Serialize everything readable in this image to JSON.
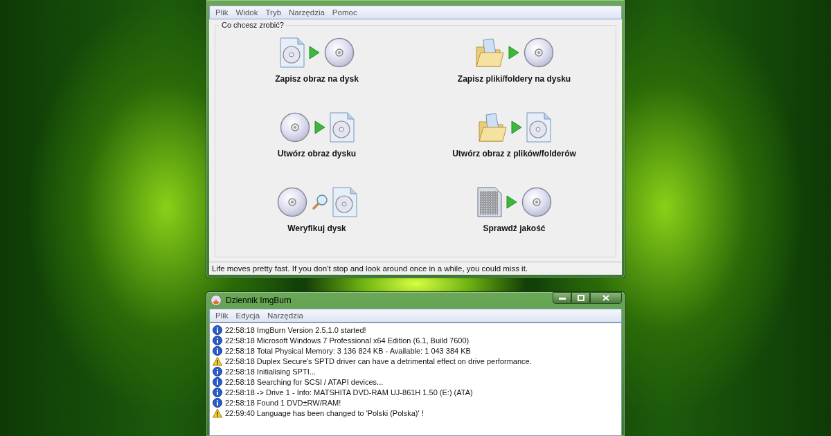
{
  "main_window": {
    "menu": [
      "Plik",
      "Widok",
      "Tryb",
      "Narzędzia",
      "Pomoc"
    ],
    "group_title": "Co chcesz zrobić?",
    "tasks": [
      {
        "label": "Zapisz obraz na dysk",
        "icons": [
          {
            "kind": "image"
          },
          {
            "kind": "arrow"
          },
          {
            "kind": "disc"
          }
        ]
      },
      {
        "label": "Zapisz pliki/foldery na dysku",
        "icons": [
          {
            "kind": "folder"
          },
          {
            "kind": "arrow"
          },
          {
            "kind": "disc"
          }
        ]
      },
      {
        "label": "Utwórz obraz dysku",
        "icons": [
          {
            "kind": "disc"
          },
          {
            "kind": "arrow"
          },
          {
            "kind": "image"
          }
        ]
      },
      {
        "label": "Utwórz obraz z plików/folderów",
        "icons": [
          {
            "kind": "folder"
          },
          {
            "kind": "arrow"
          },
          {
            "kind": "image"
          }
        ]
      },
      {
        "label": "Weryfikuj dysk",
        "icons": [
          {
            "kind": "disc"
          },
          {
            "kind": "magnifier"
          },
          {
            "kind": "image"
          }
        ]
      },
      {
        "label": "Sprawdź jakość",
        "icons": [
          {
            "kind": "pattern"
          },
          {
            "kind": "arrow"
          },
          {
            "kind": "disc"
          }
        ]
      }
    ],
    "status_bar": "Life moves pretty fast. If you don't stop and look around once in a while, you could miss it."
  },
  "log_window": {
    "title": "Dziennik ImgBurn",
    "menu": [
      "Plik",
      "Edycja",
      "Narzędzia"
    ],
    "entries": [
      {
        "kind": "info",
        "text": "22:58:18 ImgBurn Version 2.5.1.0 started!"
      },
      {
        "kind": "info",
        "text": "22:58:18 Microsoft Windows 7 Professional x64 Edition (6.1, Build 7600)"
      },
      {
        "kind": "info",
        "text": "22:58:18 Total Physical Memory: 3 136 824 KB  -  Available: 1 043 384 KB"
      },
      {
        "kind": "warning",
        "text": "22:58:18 Duplex Secure's SPTD driver can have a detrimental effect on drive performance."
      },
      {
        "kind": "info",
        "text": "22:58:18 Initialising SPTI..."
      },
      {
        "kind": "info",
        "text": "22:58:18 Searching for SCSI / ATAPI devices..."
      },
      {
        "kind": "info",
        "text": "22:58:18 -> Drive 1 - Info: MATSHITA DVD-RAM UJ-861H 1.50 (E:) (ATA)"
      },
      {
        "kind": "info",
        "text": "22:58:18 Found 1 DVD±RW/RAM!"
      },
      {
        "kind": "warning",
        "text": "22:59:40 Language has been changed to 'Polski (Polska)' !"
      }
    ]
  }
}
